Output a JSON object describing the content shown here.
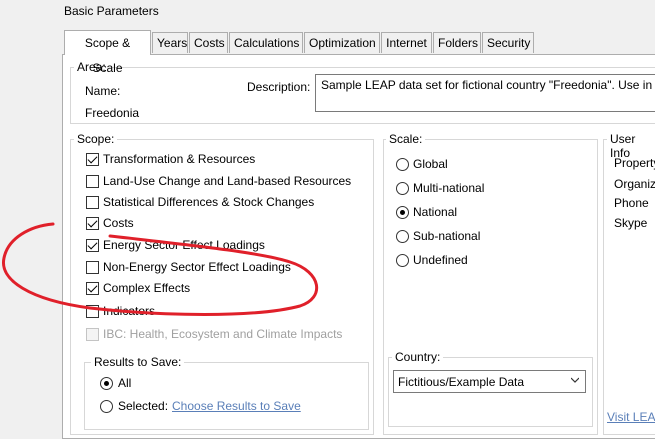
{
  "window": {
    "title": "Basic Parameters"
  },
  "tabs": [
    {
      "label": "Scope & Scale"
    },
    {
      "label": "Years"
    },
    {
      "label": "Costs"
    },
    {
      "label": "Calculations"
    },
    {
      "label": "Optimization"
    },
    {
      "label": "Internet"
    },
    {
      "label": "Folders"
    },
    {
      "label": "Security"
    }
  ],
  "area": {
    "group_label": "Area:",
    "name_label": "Name:",
    "name_value": "Freedonia",
    "description_label": "Description:",
    "description_value": "Sample LEAP data set for fictional country \"Freedonia\". Use in c"
  },
  "scope": {
    "group_label": "Scope:",
    "items": [
      {
        "label": "Transformation & Resources",
        "checked": true,
        "enabled": true
      },
      {
        "label": "Land-Use Change and Land-based Resources",
        "checked": false,
        "enabled": true
      },
      {
        "label": "Statistical Differences & Stock Changes",
        "checked": false,
        "enabled": true
      },
      {
        "label": "Costs",
        "checked": true,
        "enabled": true
      },
      {
        "label": "Energy Sector Effect Loadings",
        "checked": true,
        "enabled": true
      },
      {
        "label": "Non-Energy Sector Effect Loadings",
        "checked": false,
        "enabled": true
      },
      {
        "label": "Complex Effects",
        "checked": true,
        "enabled": true
      },
      {
        "label": "Indicators",
        "checked": false,
        "enabled": true
      },
      {
        "label": "IBC: Health, Ecosystem and Climate Impacts",
        "checked": false,
        "enabled": false
      }
    ]
  },
  "results": {
    "group_label": "Results to Save:",
    "all_label": "All",
    "selected_label": "Selected:",
    "choose_link": "Choose Results to Save",
    "selected_option": "All"
  },
  "scale": {
    "group_label": "Scale:",
    "options": [
      {
        "label": "Global",
        "checked": false
      },
      {
        "label": "Multi-national",
        "checked": false
      },
      {
        "label": "National",
        "checked": true
      },
      {
        "label": "Sub-national",
        "checked": false
      },
      {
        "label": "Undefined",
        "checked": false
      }
    ]
  },
  "country": {
    "group_label": "Country:",
    "selected": "Fictitious/Example Data"
  },
  "user_info": {
    "group_label": "User Info",
    "rows": [
      "Property",
      "Organiz",
      "Phone",
      "Skype"
    ],
    "link": "Visit LEAP"
  },
  "annotation": {
    "color": "#e0202a"
  }
}
